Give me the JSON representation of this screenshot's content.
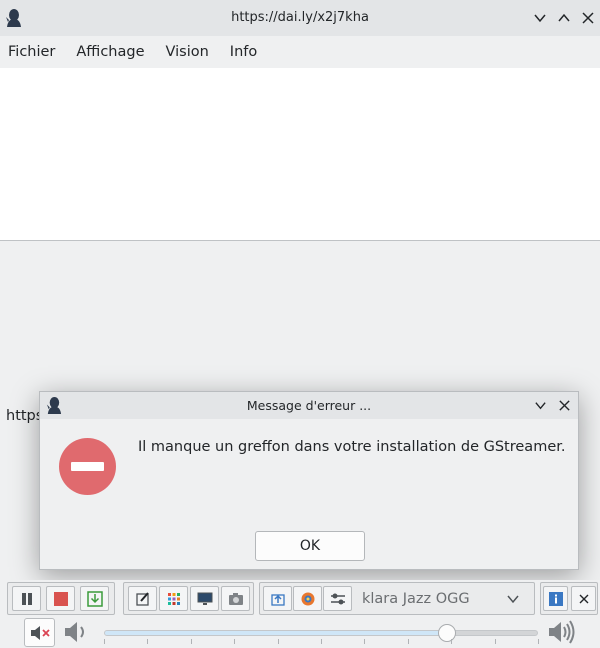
{
  "window": {
    "title": "https://dai.ly/x2j7kha"
  },
  "menu": {
    "items": [
      "Fichier",
      "Affichage",
      "Vision",
      "Info"
    ]
  },
  "status": {
    "url_peek": "https:"
  },
  "dialog": {
    "title": "Message d'erreur ...",
    "message": "Il manque un greffon dans votre installation de GStreamer.",
    "ok_label": "OK",
    "icon": "error-icon"
  },
  "toolbar": {
    "channel_selected": "klara Jazz OGG",
    "icons": [
      "pause-icon",
      "stop-icon",
      "record-icon",
      "edit-icon",
      "grid-icon",
      "monitor-icon",
      "camera-icon",
      "upload-icon",
      "browser-icon",
      "settings-icon",
      "info-icon",
      "close-icon"
    ]
  },
  "volume": {
    "level": 0.79,
    "muted": true
  },
  "colors": {
    "error": "#e06a6e",
    "accent": "#3daee9",
    "info": "#3a78c3"
  }
}
